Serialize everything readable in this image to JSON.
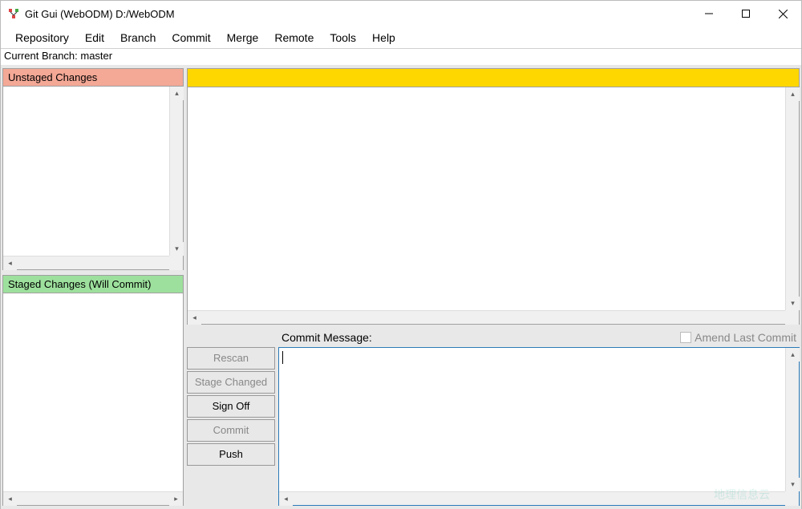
{
  "title": "Git Gui (WebODM) D:/WebODM",
  "menu": {
    "repository": "Repository",
    "edit": "Edit",
    "branch": "Branch",
    "commit": "Commit",
    "merge": "Merge",
    "remote": "Remote",
    "tools": "Tools",
    "help": "Help"
  },
  "branch_bar": "Current Branch: master",
  "panels": {
    "unstaged": "Unstaged Changes",
    "staged": "Staged Changes (Will Commit)"
  },
  "commit": {
    "label": "Commit Message:",
    "amend": "Amend Last Commit",
    "message": ""
  },
  "buttons": {
    "rescan": "Rescan",
    "stage_changed": "Stage Changed",
    "sign_off": "Sign Off",
    "commit": "Commit",
    "push": "Push"
  },
  "watermark": "地理信息云"
}
